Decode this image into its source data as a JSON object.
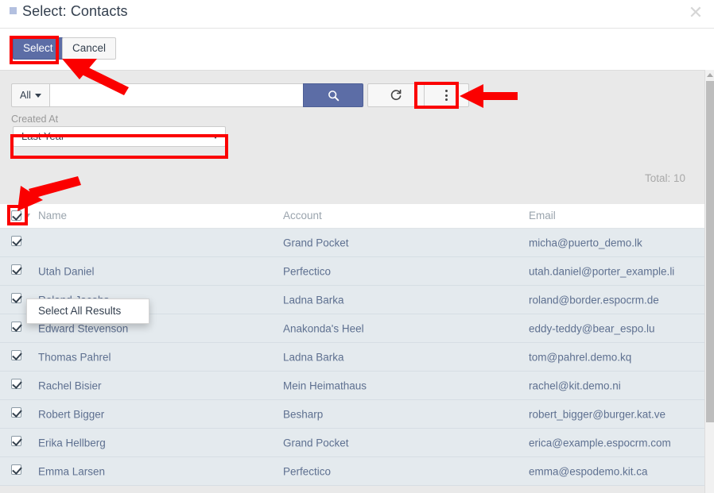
{
  "modal": {
    "title": "Select: Contacts",
    "title_icon": "square-icon",
    "close_icon": "close-icon"
  },
  "toolbar": {
    "select_label": "Select",
    "cancel_label": "Cancel"
  },
  "search": {
    "scope_label": "All",
    "value": "",
    "placeholder": "",
    "search_icon": "search-icon",
    "refresh_icon": "refresh-icon",
    "menu_icon": "vertical-dots-icon"
  },
  "filters": [
    {
      "label": "Created At",
      "value": "Last Year"
    }
  ],
  "list": {
    "total_text": "Total: 10",
    "columns": [
      "Name",
      "Account",
      "Email"
    ],
    "rows": [
      {
        "name": "",
        "account": "Grand Pocket",
        "email": "micha@puerto_demo.lk",
        "checked": true
      },
      {
        "name": "Utah Daniel",
        "account": "Perfectico",
        "email": "utah.daniel@porter_example.li",
        "checked": true
      },
      {
        "name": "Roland Jacobs",
        "account": "Ladna Barka",
        "email": "roland@border.espocrm.de",
        "checked": true
      },
      {
        "name": "Edward Stevenson",
        "account": "Anakonda's Heel",
        "email": "eddy-teddy@bear_espo.lu",
        "checked": true
      },
      {
        "name": "Thomas Pahrel",
        "account": "Ladna Barka",
        "email": "tom@pahrel.demo.kq",
        "checked": true
      },
      {
        "name": "Rachel Bisier",
        "account": "Mein Heimathaus",
        "email": "rachel@kit.demo.ni",
        "checked": true
      },
      {
        "name": "Robert Bigger",
        "account": "Besharp",
        "email": "robert_bigger@burger.kat.ve",
        "checked": true
      },
      {
        "name": "Erika Hellberg",
        "account": "Grand Pocket",
        "email": "erica@example.espocrm.com",
        "checked": true
      },
      {
        "name": "Emma Larsen",
        "account": "Perfectico",
        "email": "emma@espodemo.kit.ca",
        "checked": true
      }
    ],
    "header_checkbox_checked": true
  },
  "dropdown": {
    "items": [
      "Select All Results"
    ]
  },
  "colors": {
    "accent": "#5c6da6",
    "annotation": "#fb0000",
    "row_bg": "#e4eaee",
    "panel_bg": "#e9e9e9",
    "link_text": "#5e7090"
  }
}
